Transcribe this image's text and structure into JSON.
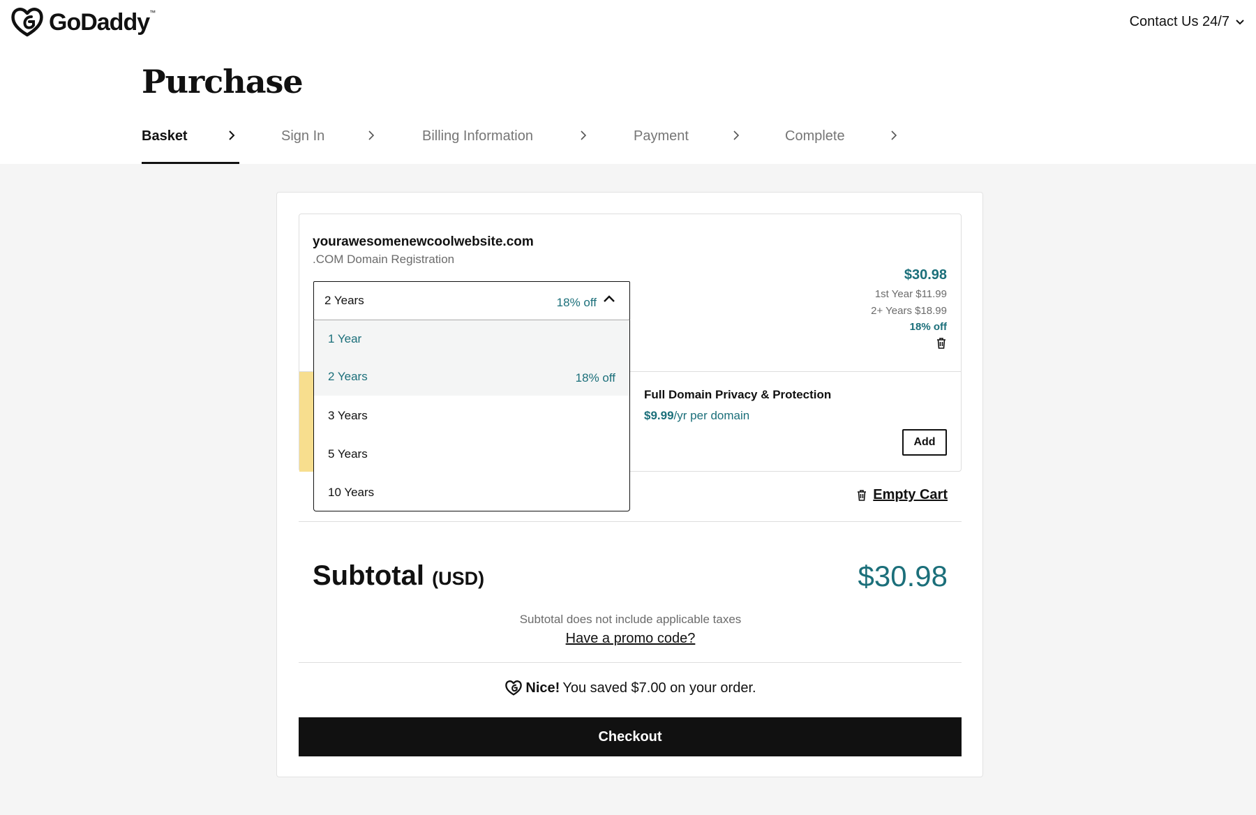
{
  "brand": {
    "name": "GoDaddy",
    "tm": "™"
  },
  "header": {
    "contact_label": "Contact Us 24/7"
  },
  "page": {
    "title": "Purchase"
  },
  "steps": [
    {
      "label": "Basket",
      "active": true
    },
    {
      "label": "Sign In",
      "active": false
    },
    {
      "label": "Billing Information",
      "active": false
    },
    {
      "label": "Payment",
      "active": false
    },
    {
      "label": "Complete",
      "active": false
    }
  ],
  "item": {
    "domain": "yourawesomenewcoolwebsite.com",
    "product": ".COM Domain Registration",
    "price": "$30.98",
    "first_year": "1st Year $11.99",
    "later_years": "2+ Years $18.99",
    "discount": "18% off"
  },
  "term_select": {
    "selected": "2 Years",
    "selected_discount": "18% off",
    "options": [
      {
        "label": "1 Year",
        "discount": ""
      },
      {
        "label": "2 Years",
        "discount": "18% off"
      },
      {
        "label": "3 Years",
        "discount": ""
      },
      {
        "label": "5 Years",
        "discount": ""
      },
      {
        "label": "10 Years",
        "discount": ""
      }
    ]
  },
  "addon": {
    "title": "Full Domain Privacy & Protection",
    "price": "$9.99",
    "price_suffix": "/yr per domain",
    "add_label": "Add"
  },
  "cart": {
    "empty_label": "Empty Cart"
  },
  "summary": {
    "subtotal_label": "Subtotal",
    "currency": "(USD)",
    "subtotal_value": "$30.98",
    "tax_note": "Subtotal does not include applicable taxes",
    "promo_link": "Have a promo code?",
    "saved_bold": "Nice!",
    "saved_text": "You saved $7.00 on your order.",
    "checkout_label": "Checkout"
  },
  "colors": {
    "accent_teal": "#1b6f7a",
    "addon_yellow": "#f7de8e",
    "checkout_black": "#111111"
  }
}
